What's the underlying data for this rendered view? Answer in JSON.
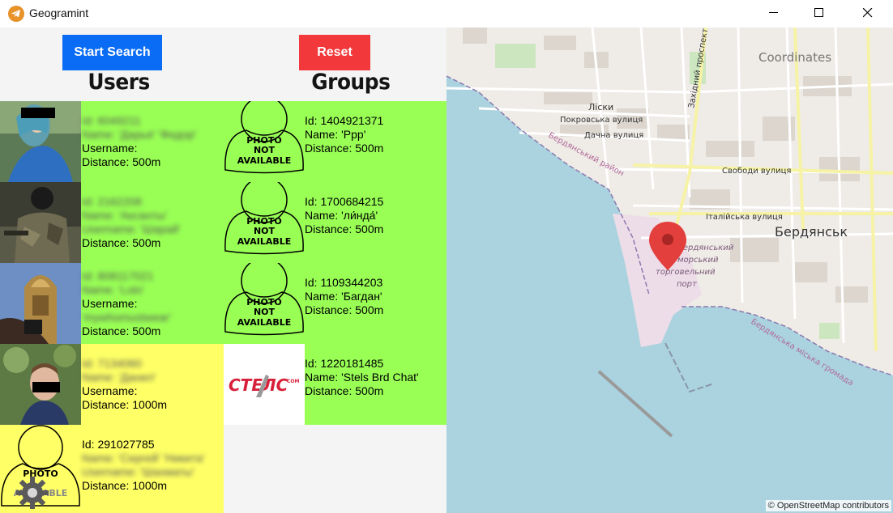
{
  "window": {
    "title": "Geogramint",
    "minimize_glyph": "—",
    "close_glyph": "✕"
  },
  "controls": {
    "start_label": "Start Search",
    "reset_label": "Reset"
  },
  "headings": {
    "users": "Users",
    "groups": "Groups"
  },
  "users": [
    {
      "id": "Id: 6049211",
      "name": "Name: 'Дарья' 'Федор'",
      "username": "Username:",
      "distance": "Distance: 500m",
      "color": "#99ff55",
      "avatar": "photo"
    },
    {
      "id": "Id: 2162208",
      "name": "Name: 'Аксанты'",
      "username": "Username: 'Шарай'",
      "distance": "Distance: 500m",
      "color": "#99ff55",
      "avatar": "photo"
    },
    {
      "id": "Id: 808117021",
      "name": "Name: 'Lolo'",
      "username": "Username:",
      "distance": "Distance: 500m",
      "color": "#99ff55",
      "avatar": "photo",
      "extra": "'mywhomustwear'"
    },
    {
      "id": "Id: 7134060",
      "name": "Name: 'Данил'",
      "username": "Username:",
      "distance": "Distance: 1000m",
      "color": "#ffff66",
      "avatar": "photo"
    },
    {
      "id": "Id: 291027785",
      "name": "Name: 'Сергей' 'Никита'",
      "username": "Username: 'Шахматы'",
      "distance": "Distance: 1000m",
      "color": "#ffff66",
      "avatar": "none"
    }
  ],
  "groups": [
    {
      "id": "Id: 1404921371",
      "name": "Name: 'Ppp'",
      "distance": "Distance: 500m",
      "avatar": "none"
    },
    {
      "id": "Id: 1700684215",
      "name": "Name: 'ли́нда́'",
      "distance": "Distance: 500m",
      "avatar": "none"
    },
    {
      "id": "Id: 1109344203",
      "name": "Name: 'Багдан'",
      "distance": "Distance: 500m",
      "avatar": "none"
    },
    {
      "id": "Id: 1220181485",
      "name": "Name: 'Stels Brd Chat'",
      "distance": "Distance: 500m",
      "avatar": "logo",
      "logo_text": "СТЕЛС",
      "logo_sub": "COM"
    }
  ],
  "photo_placeholder": {
    "line1": "PHOTO",
    "line2": "NOT",
    "line3": "AVAILABLE"
  },
  "map": {
    "coordinates_label": "Coordinates",
    "attribution": "© OpenStreetMap contributors",
    "labels": {
      "liski": "Ліски",
      "pokrovska": "Покровська вулиця",
      "dachna": "Дачна вулиця",
      "berdiansk_raion": "Бердянський район",
      "svobody": "Свободи вулиця",
      "italiiska": "Італійська вулиця",
      "city": "Бердянськ",
      "port1": "Бердянський",
      "port2": "морський",
      "port3": "торговельний",
      "port4": "порт",
      "hromada": "Бердянська міська громада",
      "prospekt": "Західний проспект"
    }
  }
}
